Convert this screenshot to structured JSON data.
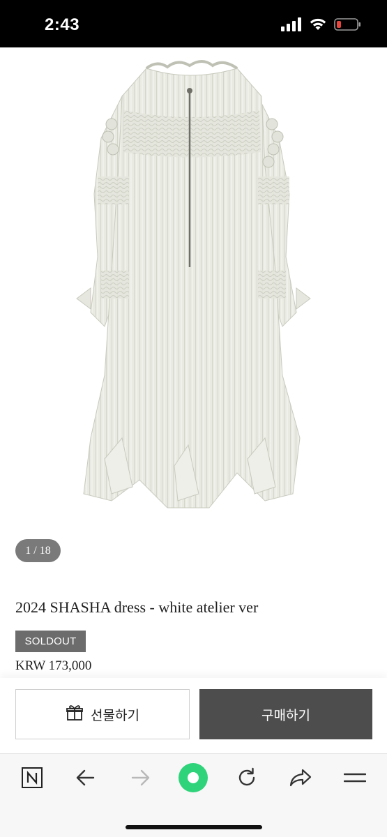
{
  "status_bar": {
    "time": "2:43",
    "battery_color": "#e8453c"
  },
  "gallery": {
    "image_alt": "2024 SHASHA dress - white atelier ver",
    "counter": "1 / 18"
  },
  "product": {
    "title": "2024 SHASHA dress - white atelier ver",
    "status_badge": "SOLDOUT",
    "price": "KRW 173,000"
  },
  "actions": {
    "gift_label": "선물하기",
    "buy_label": "구매하기"
  },
  "browser_toolbar": {
    "items": [
      "naver-logo-icon",
      "back-arrow-icon",
      "forward-arrow-icon",
      "green-dot-icon",
      "reload-icon",
      "share-icon",
      "menu-icon"
    ],
    "accent_color": "#2fd37a"
  }
}
